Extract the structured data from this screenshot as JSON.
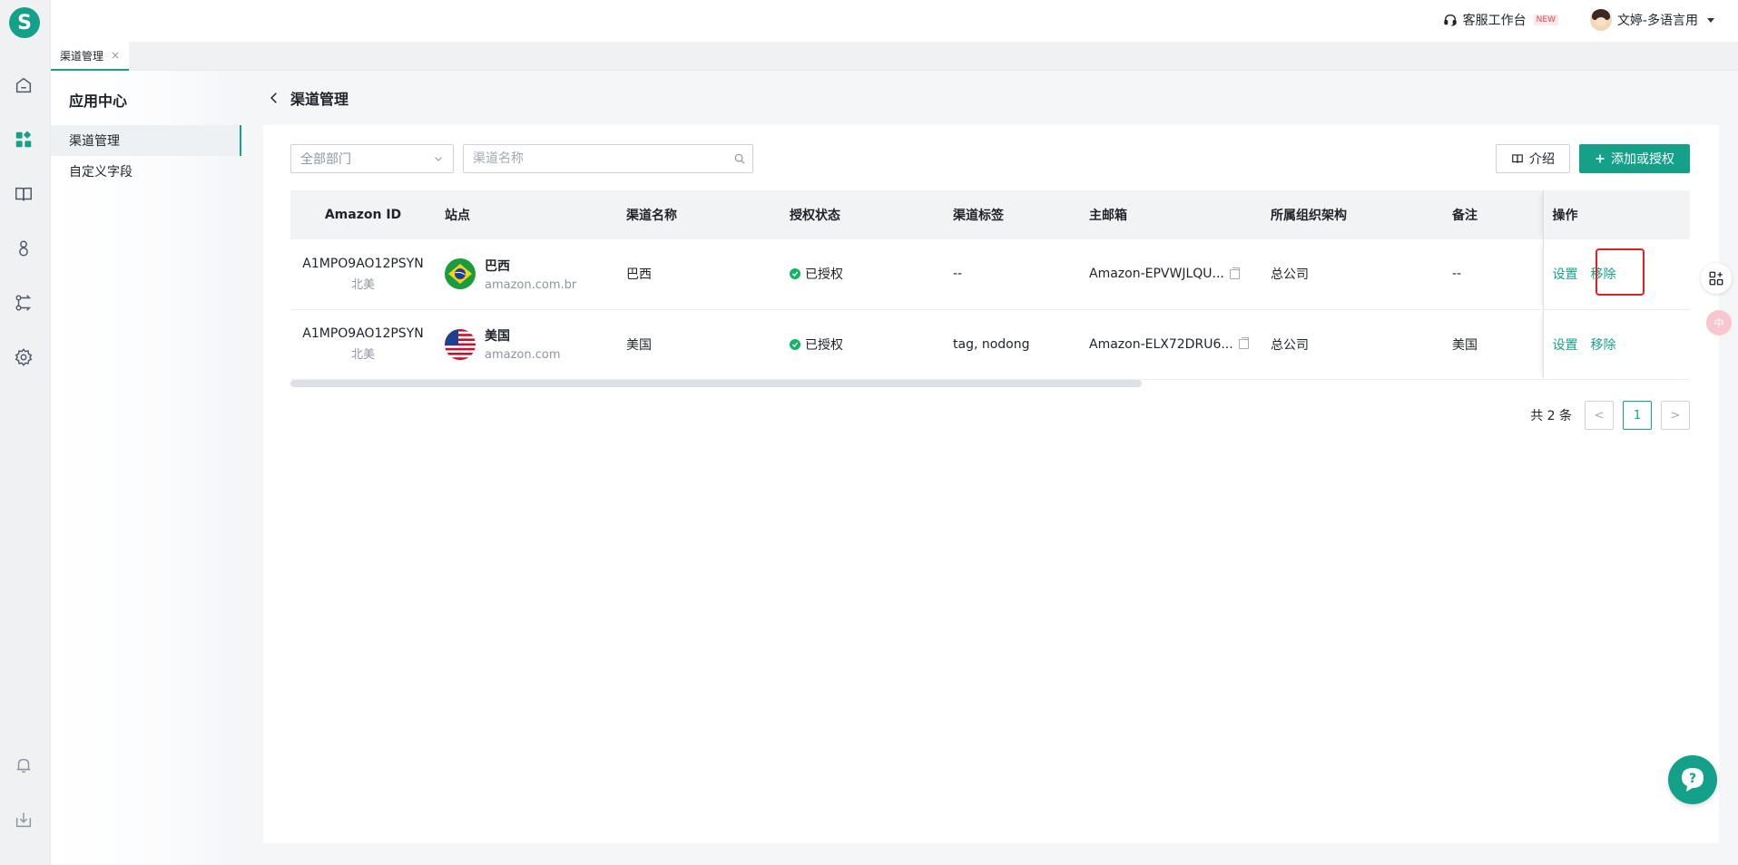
{
  "brand": {
    "logo_letter": "S",
    "accent": "#15a08a"
  },
  "rail": {
    "icons": [
      "home-icon",
      "apps-icon",
      "book-icon",
      "user-group-icon",
      "flow-icon",
      "gear-icon",
      "bell-icon",
      "download-icon"
    ]
  },
  "topbar": {
    "workspace_label": "客服工作台",
    "new_badge": "NEW",
    "user_name": "文婷-多语言用"
  },
  "tabs": [
    {
      "label": "渠道管理",
      "close": "×"
    }
  ],
  "sidebar": {
    "title": "应用中心",
    "items": [
      {
        "label": "渠道管理",
        "active": true
      },
      {
        "label": "自定义字段",
        "active": false
      }
    ]
  },
  "page": {
    "title": "渠道管理"
  },
  "filters": {
    "department_placeholder": "全部部门",
    "search_placeholder": "渠道名称"
  },
  "actions": {
    "intro_label": "介绍",
    "add_label": "添加或授权"
  },
  "table": {
    "columns": [
      "Amazon ID",
      "站点",
      "渠道名称",
      "授权状态",
      "渠道标签",
      "主邮箱",
      "所属组织架构",
      "备注",
      "操作"
    ],
    "rows": [
      {
        "amazon_id": "A1MPO9AO12PSYN",
        "region": "北美",
        "site_name": "巴西",
        "site_url": "amazon.com.br",
        "channel_name": "巴西",
        "auth_status": "已授权",
        "tags": "--",
        "email": "Amazon-EPVWJLQU...",
        "org": "总公司",
        "note": "--",
        "op_settings": "设置",
        "op_remove": "移除"
      },
      {
        "amazon_id": "A1MPO9AO12PSYN",
        "region": "北美",
        "site_name": "美国",
        "site_url": "amazon.com",
        "channel_name": "美国",
        "auth_status": "已授权",
        "tags": "tag, nodong",
        "email": "Amazon-ELX72DRU6...",
        "org": "总公司",
        "note": "美国",
        "op_settings": "设置",
        "op_remove": "移除"
      }
    ]
  },
  "pagination": {
    "total_text": "共 2 条",
    "prev": "<",
    "current": "1",
    "next": ">"
  },
  "floating": {
    "lang_badge": "中",
    "help": "?"
  }
}
